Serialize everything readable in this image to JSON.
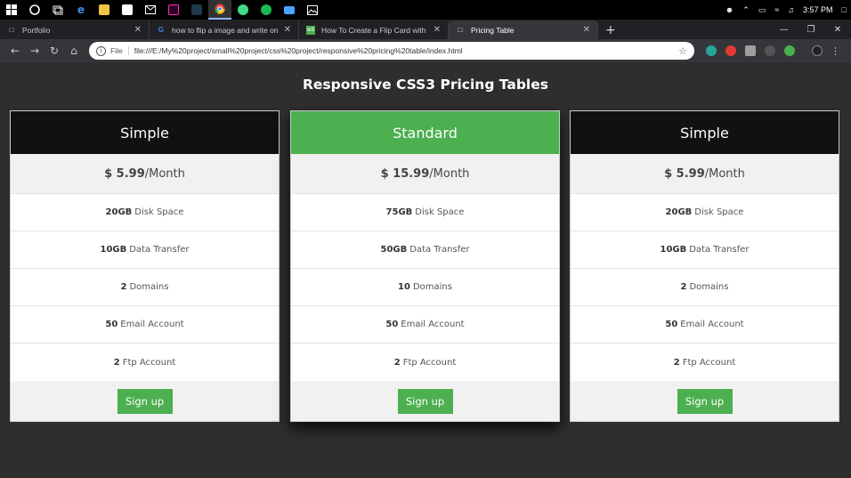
{
  "taskbar": {
    "apps": [
      {
        "icon": "start-icon",
        "color": "#ffffff"
      },
      {
        "icon": "cortana-icon",
        "color": "#ffffff"
      },
      {
        "icon": "task-view-icon",
        "color": "#ffffff"
      },
      {
        "icon": "edge-icon",
        "color": "#3a8ee6"
      },
      {
        "icon": "file-explorer-icon",
        "color": "#f4c542"
      },
      {
        "icon": "store-icon",
        "color": "#ffffff"
      },
      {
        "icon": "mail-icon",
        "color": "#ffffff"
      },
      {
        "icon": "xd-icon",
        "color": "#ff2bc2"
      },
      {
        "icon": "terminal-icon",
        "color": "#4fc3f7"
      },
      {
        "icon": "chrome-icon",
        "color": "#ea4335"
      },
      {
        "icon": "app-green-icon",
        "color": "#3ddc84"
      },
      {
        "icon": "spotify-icon",
        "color": "#1db954"
      },
      {
        "icon": "display-icon",
        "color": "#4aa3ff"
      },
      {
        "icon": "photos-icon",
        "color": "#ffffff"
      }
    ],
    "time": "3:57 PM"
  },
  "browser": {
    "tabs": [
      {
        "title": "Portfolio",
        "active": false
      },
      {
        "title": "how to flip a image and write on",
        "active": false
      },
      {
        "title": "How To Create a Flip Card with C",
        "active": false
      },
      {
        "title": "Pricing Table",
        "active": true
      }
    ],
    "new_tab": "+",
    "scheme": "File",
    "url": "file:///E:/My%20project/small%20project/css%20project/responsive%20pricing%20table/index.html"
  },
  "page": {
    "title": "Responsive CSS3 Pricing Tables",
    "accent": "#4caf50",
    "plans": [
      {
        "name": "Simple",
        "price": "$ 5.99",
        "period": "/Month",
        "features": [
          {
            "value": "20GB",
            "label": "Disk Space"
          },
          {
            "value": "10GB",
            "label": "Data Transfer"
          },
          {
            "value": "2",
            "label": "Domains"
          },
          {
            "value": "50",
            "label": "Email Account"
          },
          {
            "value": "2",
            "label": "Ftp Account"
          }
        ],
        "button": "Sign up"
      },
      {
        "name": "Standard",
        "price": "$ 15.99",
        "period": "/Month",
        "features": [
          {
            "value": "75GB",
            "label": "Disk Space"
          },
          {
            "value": "50GB",
            "label": "Data Transfer"
          },
          {
            "value": "10",
            "label": "Domains"
          },
          {
            "value": "50",
            "label": "Email Account"
          },
          {
            "value": "2",
            "label": "Ftp Account"
          }
        ],
        "button": "Sign up"
      },
      {
        "name": "Simple",
        "price": "$ 5.99",
        "period": "/Month",
        "features": [
          {
            "value": "20GB",
            "label": "Disk Space"
          },
          {
            "value": "10GB",
            "label": "Data Transfer"
          },
          {
            "value": "2",
            "label": "Domains"
          },
          {
            "value": "50",
            "label": "Email Account"
          },
          {
            "value": "2",
            "label": "Ftp Account"
          }
        ],
        "button": "Sign up"
      }
    ]
  }
}
